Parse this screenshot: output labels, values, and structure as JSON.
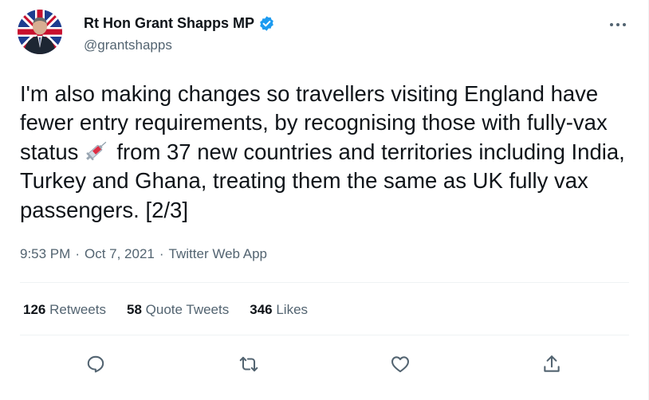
{
  "author": {
    "name": "Rt Hon Grant Shapps MP",
    "handle": "@grantshapps",
    "avatar_icon": "user-avatar-icon",
    "verified_icon": "verified-badge-icon",
    "verified_color": "#1d9bf0"
  },
  "tweet": {
    "text_part1": "I'm also making changes so travellers visiting England have fewer entry requirements, by recognising those with fully-vax status",
    "emoji_icon": "syringe-icon",
    "text_part2": "from 37 new countries and territories including India, Turkey and Ghana, treating them the same as UK fully vax passengers. [2/3]"
  },
  "meta": {
    "time": "9:53 PM",
    "separator": "·",
    "date": "Oct 7, 2021",
    "source": "Twitter Web App"
  },
  "stats": {
    "retweets_count": "126",
    "retweets_label": "Retweets",
    "quotes_count": "58",
    "quotes_label": "Quote Tweets",
    "likes_count": "346",
    "likes_label": "Likes"
  },
  "actions": [
    "reply-icon",
    "retweet-icon",
    "like-icon",
    "share-icon"
  ],
  "colors": {
    "text": "#0f1419",
    "secondary": "#536471",
    "divider": "#eff3f4"
  }
}
